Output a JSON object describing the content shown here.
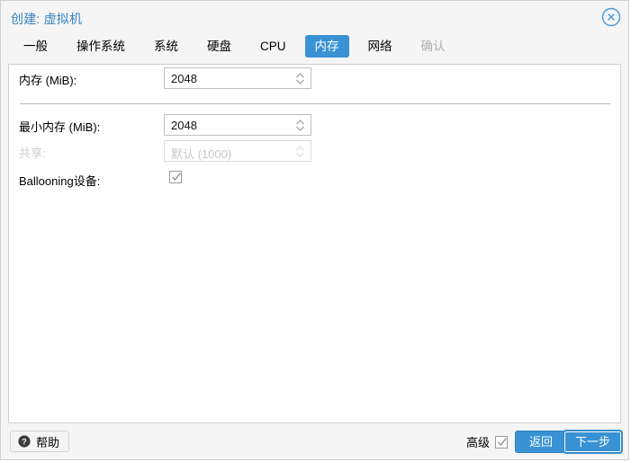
{
  "window": {
    "title": "创建: 虚拟机",
    "close_icon": "close-circle-icon"
  },
  "tabs": [
    {
      "label": "一般",
      "state": "normal"
    },
    {
      "label": "操作系统",
      "state": "normal"
    },
    {
      "label": "系统",
      "state": "normal"
    },
    {
      "label": "硬盘",
      "state": "normal"
    },
    {
      "label": "CPU",
      "state": "normal"
    },
    {
      "label": "内存",
      "state": "active"
    },
    {
      "label": "网络",
      "state": "normal"
    },
    {
      "label": "确认",
      "state": "disabled"
    }
  ],
  "form": {
    "rows": [
      {
        "label": "内存 (MiB):",
        "type": "spinner",
        "value": "2048",
        "placeholder": "",
        "disabled": false
      },
      {
        "label": "最小内存 (MiB):",
        "type": "spinner",
        "value": "2048",
        "placeholder": "",
        "disabled": false
      },
      {
        "label": "共享:",
        "type": "spinner",
        "value": "默认 (1000)",
        "placeholder": "默认 (1000)",
        "disabled": true
      },
      {
        "label": "Ballooning设备:",
        "type": "checkbox",
        "checked": true,
        "disabled": false
      }
    ]
  },
  "footer": {
    "help_label": "帮助",
    "help_icon": "help-circle-icon",
    "advanced_label": "高级",
    "advanced_checked": true,
    "back_label": "返回",
    "next_label": "下一步"
  },
  "colors": {
    "accent": "#3892d4",
    "title": "#3582c4",
    "window_bg": "#f5f5f5",
    "content_bg": "#ffffff",
    "border": "#cfcfcf",
    "disabled_text": "#b0b0b0"
  }
}
